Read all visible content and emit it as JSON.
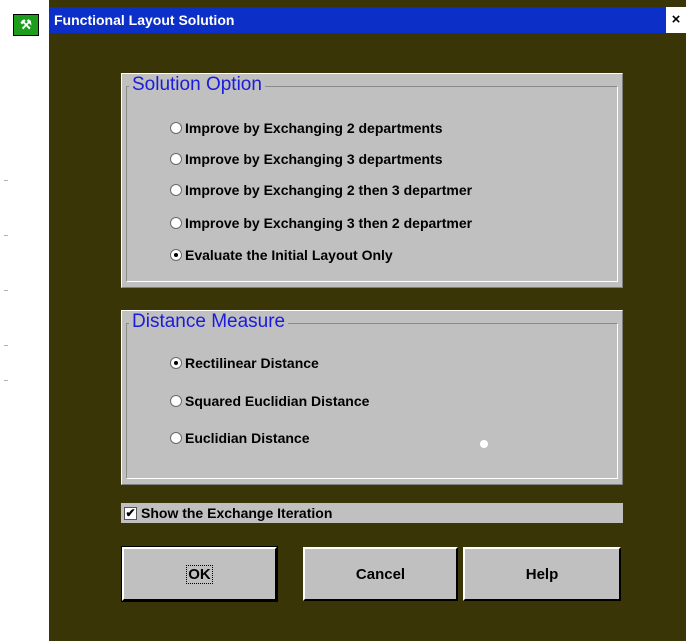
{
  "window": {
    "title": "Functional Layout Solution",
    "close_label": "×",
    "icon_name": "app-icon"
  },
  "solution_option": {
    "title": "Solution Option",
    "options": [
      {
        "label": "Improve by Exchanging 2 departments",
        "selected": false
      },
      {
        "label": "Improve by Exchanging 3 departments",
        "selected": false
      },
      {
        "label": "Improve by Exchanging 2 then 3 departmer",
        "selected": false
      },
      {
        "label": "Improve by Exchanging 3 then 2 departmer",
        "selected": false
      },
      {
        "label": "Evaluate the Initial Layout Only",
        "selected": true
      }
    ]
  },
  "distance_measure": {
    "title": "Distance Measure",
    "options": [
      {
        "label": "Rectilinear Distance",
        "selected": true
      },
      {
        "label": "Squared Euclidian Distance",
        "selected": false
      },
      {
        "label": "Euclidian Distance",
        "selected": false
      }
    ]
  },
  "show_iteration": {
    "label": "Show the Exchange Iteration",
    "checked": true,
    "check_glyph": "✔"
  },
  "buttons": {
    "ok": "OK",
    "cancel": "Cancel",
    "help": "Help"
  },
  "colors": {
    "titlebar": "#0c2fc8",
    "dialog_bg": "#3a3506",
    "group_bg": "#c0c0c0",
    "group_title": "#1b1bdc"
  }
}
